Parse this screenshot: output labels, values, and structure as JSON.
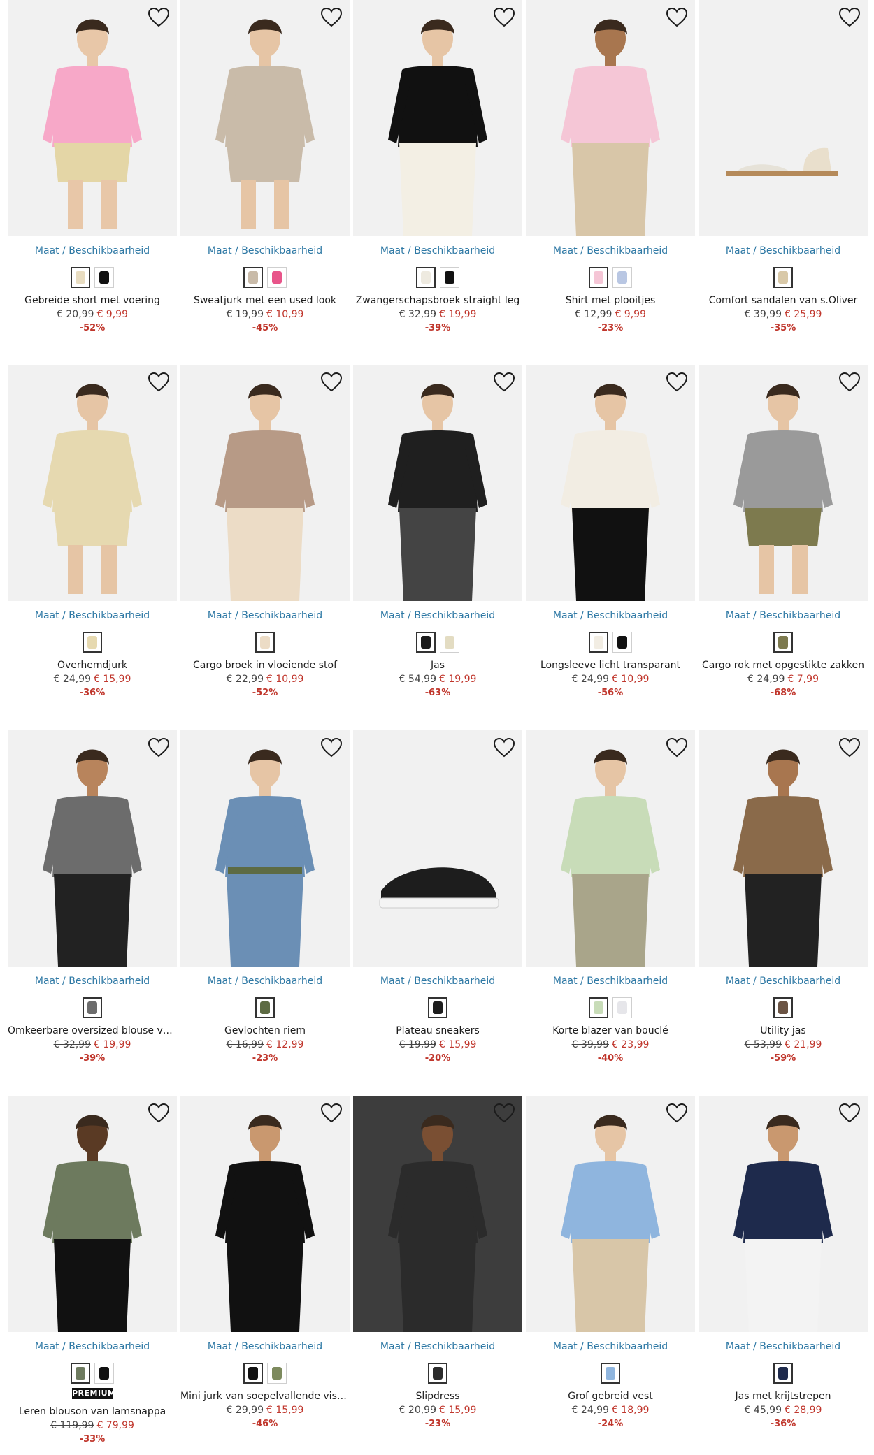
{
  "size_label": "Maat / Beschikbaarheid",
  "products": [
    {
      "name": "Gebreide short met voering",
      "old_price": "€ 20,99",
      "price": "€ 9,99",
      "discount": "-52%",
      "swatches": [
        "#e8dcc0",
        "#111111"
      ],
      "premium": ""
    },
    {
      "name": "Sweatjurk met een used look",
      "old_price": "€ 19,99",
      "price": "€ 10,99",
      "discount": "-45%",
      "swatches": [
        "#c9bba9",
        "#e8558a"
      ],
      "premium": ""
    },
    {
      "name": "Zwangerschapsbroek straight leg",
      "old_price": "€ 32,99",
      "price": "€ 19,99",
      "discount": "-39%",
      "swatches": [
        "#eeeae0",
        "#111111"
      ],
      "premium": ""
    },
    {
      "name": "Shirt met plooitjes",
      "old_price": "€ 12,99",
      "price": "€ 9,99",
      "discount": "-23%",
      "swatches": [
        "#f5c6d6",
        "#b9c7e3"
      ],
      "premium": ""
    },
    {
      "name": "Comfort sandalen van s.Oliver",
      "old_price": "€ 39,99",
      "price": "€ 25,99",
      "discount": "-35%",
      "swatches": [
        "#d9c9a8"
      ],
      "premium": ""
    },
    {
      "name": "Overhemdjurk",
      "old_price": "€ 24,99",
      "price": "€ 15,99",
      "discount": "-36%",
      "swatches": [
        "#e6d9b0"
      ],
      "premium": ""
    },
    {
      "name": "Cargo broek in vloeiende stof",
      "old_price": "€ 22,99",
      "price": "€ 10,99",
      "discount": "-52%",
      "swatches": [
        "#ecdcc6"
      ],
      "premium": ""
    },
    {
      "name": "Jas",
      "old_price": "€ 54,99",
      "price": "€ 19,99",
      "discount": "-63%",
      "swatches": [
        "#1b1b1b",
        "#e3dcc2"
      ],
      "premium": ""
    },
    {
      "name": "Longsleeve licht transparant",
      "old_price": "€ 24,99",
      "price": "€ 10,99",
      "discount": "-56%",
      "swatches": [
        "#f2ede3",
        "#111111"
      ],
      "premium": ""
    },
    {
      "name": "Cargo rok met opgestikte zakken",
      "old_price": "€ 24,99",
      "price": "€ 7,99",
      "discount": "-68%",
      "swatches": [
        "#7d7a4e"
      ],
      "premium": ""
    },
    {
      "name": "Omkeerbare oversized blouse van v...",
      "old_price": "€ 32,99",
      "price": "€ 19,99",
      "discount": "-39%",
      "swatches": [
        "#6c6c6c"
      ],
      "premium": ""
    },
    {
      "name": "Gevlochten riem",
      "old_price": "€ 16,99",
      "price": "€ 12,99",
      "discount": "-23%",
      "swatches": [
        "#5d6b43"
      ],
      "premium": ""
    },
    {
      "name": "Plateau sneakers",
      "old_price": "€ 19,99",
      "price": "€ 15,99",
      "discount": "-20%",
      "swatches": [
        "#1d1d1d"
      ],
      "premium": ""
    },
    {
      "name": "Korte blazer van bouclé",
      "old_price": "€ 39,99",
      "price": "€ 23,99",
      "discount": "-40%",
      "swatches": [
        "#c8dcb8",
        "#e6e6ea"
      ],
      "premium": ""
    },
    {
      "name": "Utility jas",
      "old_price": "€ 53,99",
      "price": "€ 21,99",
      "discount": "-59%",
      "swatches": [
        "#6b5444"
      ],
      "premium": ""
    },
    {
      "name": "Leren blouson van lamsnappa",
      "old_price": "€ 119,99",
      "price": "€ 79,99",
      "discount": "-33%",
      "swatches": [
        "#6d7a5e",
        "#111111"
      ],
      "premium": "PREMIUM"
    },
    {
      "name": "Mini jurk van soepelvallende viscose",
      "old_price": "€ 29,99",
      "price": "€ 15,99",
      "discount": "-46%",
      "swatches": [
        "#111111",
        "#7d8a5e"
      ],
      "premium": ""
    },
    {
      "name": "Slipdress",
      "old_price": "€ 20,99",
      "price": "€ 15,99",
      "discount": "-23%",
      "swatches": [
        "#2b2b2b"
      ],
      "premium": ""
    },
    {
      "name": "Grof gebreid vest",
      "old_price": "€ 24,99",
      "price": "€ 18,99",
      "discount": "-24%",
      "swatches": [
        "#8fb5de"
      ],
      "premium": ""
    },
    {
      "name": "Jas met krijtstrepen",
      "old_price": "€ 45,99",
      "price": "€ 28,99",
      "discount": "-36%",
      "swatches": [
        "#1e2a4c"
      ],
      "premium": ""
    }
  ],
  "colors": {
    "link": "#2f79a5",
    "sale": "#c0362c",
    "image_bg": "#f1f1f1"
  },
  "icons": {
    "wishlist": "heart-outline-icon"
  }
}
